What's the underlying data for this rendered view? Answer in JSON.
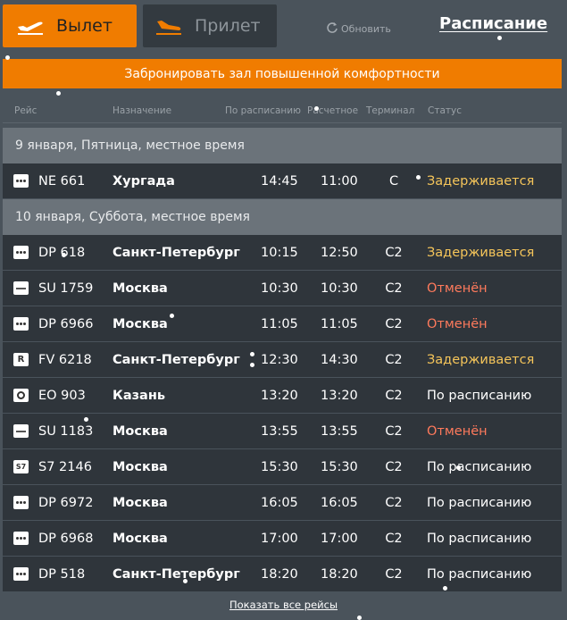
{
  "tabs": {
    "departure": {
      "label": "Вылет",
      "icon": "plane-takeoff-icon"
    },
    "arrival": {
      "label": "Прилет",
      "icon": "plane-landing-icon"
    }
  },
  "refresh_label": "Обновить",
  "schedule_label": "Расписание",
  "banner_text": "Забронировать зал повышенной комфортности",
  "columns": [
    "Рейс",
    "Назначение",
    "По расписанию",
    "Расчетное",
    "Терминал",
    "Статус"
  ],
  "groups": [
    {
      "date_label": "9 января, Пятница, местное время",
      "flights": [
        {
          "logo": "dots-logo",
          "flight": "NE 661",
          "destination": "Хургада",
          "scheduled": "14:45",
          "estimated": "11:00",
          "terminal": "C",
          "status": "Задерживается",
          "status_type": "delay"
        }
      ]
    },
    {
      "date_label": "10 января, Суббота, местное время",
      "flights": [
        {
          "logo": "dots-logo",
          "flight": "DP 618",
          "destination": "Санкт-Петербург",
          "scheduled": "10:15",
          "estimated": "12:50",
          "terminal": "C2",
          "status": "Задерживается",
          "status_type": "delay"
        },
        {
          "logo": "line-logo",
          "flight": "SU 1759",
          "destination": "Москва",
          "scheduled": "10:30",
          "estimated": "10:30",
          "terminal": "C2",
          "status": "Отменён",
          "status_type": "cancel"
        },
        {
          "logo": "dots-logo",
          "flight": "DP 6966",
          "destination": "Москва",
          "scheduled": "11:05",
          "estimated": "11:05",
          "terminal": "C2",
          "status": "Отменён",
          "status_type": "cancel"
        },
        {
          "logo": "r-logo",
          "flight": "FV 6218",
          "destination": "Санкт-Петербург",
          "scheduled": "12:30",
          "estimated": "14:30",
          "terminal": "C2",
          "status": "Задерживается",
          "status_type": "delay"
        },
        {
          "logo": "g-logo",
          "flight": "EO 903",
          "destination": "Казань",
          "scheduled": "13:20",
          "estimated": "13:20",
          "terminal": "C2",
          "status": "По расписанию",
          "status_type": "ok"
        },
        {
          "logo": "line-logo",
          "flight": "SU 1183",
          "destination": "Москва",
          "scheduled": "13:55",
          "estimated": "13:55",
          "terminal": "C2",
          "status": "Отменён",
          "status_type": "cancel"
        },
        {
          "logo": "s7-logo",
          "flight": "S7 2146",
          "destination": "Москва",
          "scheduled": "15:30",
          "estimated": "15:30",
          "terminal": "C2",
          "status": "По расписанию",
          "status_type": "ok"
        },
        {
          "logo": "dots-logo",
          "flight": "DP 6972",
          "destination": "Москва",
          "scheduled": "16:05",
          "estimated": "16:05",
          "terminal": "C2",
          "status": "По расписанию",
          "status_type": "ok"
        },
        {
          "logo": "dots-logo",
          "flight": "DP 6968",
          "destination": "Москва",
          "scheduled": "17:00",
          "estimated": "17:00",
          "terminal": "C2",
          "status": "По расписанию",
          "status_type": "ok"
        },
        {
          "logo": "dots-logo",
          "flight": "DP 518",
          "destination": "Санкт-Петербург",
          "scheduled": "18:20",
          "estimated": "18:20",
          "terminal": "C2",
          "status": "По расписанию",
          "status_type": "ok"
        }
      ]
    }
  ],
  "show_all_label": "Показать все рейсы"
}
